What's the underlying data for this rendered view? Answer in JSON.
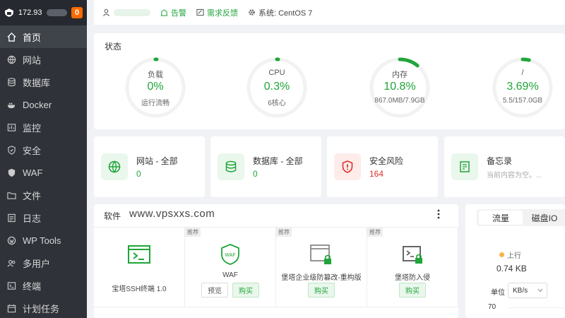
{
  "sidebar": {
    "ip": "172.93",
    "badge": "0",
    "items": [
      {
        "label": "首页",
        "icon": "home-icon"
      },
      {
        "label": "网站",
        "icon": "globe-icon"
      },
      {
        "label": "数据库",
        "icon": "database-icon"
      },
      {
        "label": "Docker",
        "icon": "docker-icon"
      },
      {
        "label": "监控",
        "icon": "monitor-icon"
      },
      {
        "label": "安全",
        "icon": "shield-icon"
      },
      {
        "label": "WAF",
        "icon": "waf-shield-icon"
      },
      {
        "label": "文件",
        "icon": "folder-icon"
      },
      {
        "label": "日志",
        "icon": "log-icon"
      },
      {
        "label": "WP Tools",
        "icon": "wordpress-icon"
      },
      {
        "label": "多用户",
        "icon": "users-icon"
      },
      {
        "label": "终端",
        "icon": "terminal-icon"
      },
      {
        "label": "计划任务",
        "icon": "calendar-icon"
      }
    ]
  },
  "topbar": {
    "alarm": "告警",
    "feedback": "需求反馈",
    "system": "系统: CentOS 7"
  },
  "status": {
    "title": "状态",
    "gauges": [
      {
        "label": "负载",
        "value": "0%",
        "sub": "运行流畅",
        "percent": 0
      },
      {
        "label": "CPU",
        "value": "0.3%",
        "sub": "6核心",
        "percent": 0.3
      },
      {
        "label": "内存",
        "value": "10.8%",
        "sub": "867.0MB/7.9GB",
        "percent": 10.8
      },
      {
        "label": "/",
        "value": "3.69%",
        "sub": "5.5/157.0GB",
        "percent": 3.69
      }
    ]
  },
  "cards": [
    {
      "title": "网站 - 全部",
      "value": "0"
    },
    {
      "title": "数据库 - 全部",
      "value": "0"
    },
    {
      "title": "安全风险",
      "value": "164"
    },
    {
      "title": "备忘录",
      "value": "当前内容为空。..."
    }
  ],
  "software": {
    "title": "软件",
    "watermark": "www.vpsxxs.com",
    "tag": "推荐",
    "items": [
      {
        "name": "宝塔SSH终端 1.0"
      },
      {
        "name": "WAF",
        "preview": "预览",
        "buy": "购买"
      },
      {
        "name": "堡塔企业级防篡改-重构版",
        "buy": "购买"
      },
      {
        "name": "堡塔防入侵",
        "buy": "购买"
      }
    ]
  },
  "traffic": {
    "tab_traffic": "流量",
    "tab_disk": "磁盘IO",
    "up_label": "上行",
    "up_value": "0.74 KB",
    "unit_label": "单位",
    "unit_value": "KB/s",
    "axis_top": "70"
  },
  "colors": {
    "accent": "#20a53a",
    "danger": "#e0302a",
    "badge": "#ff6a00"
  }
}
